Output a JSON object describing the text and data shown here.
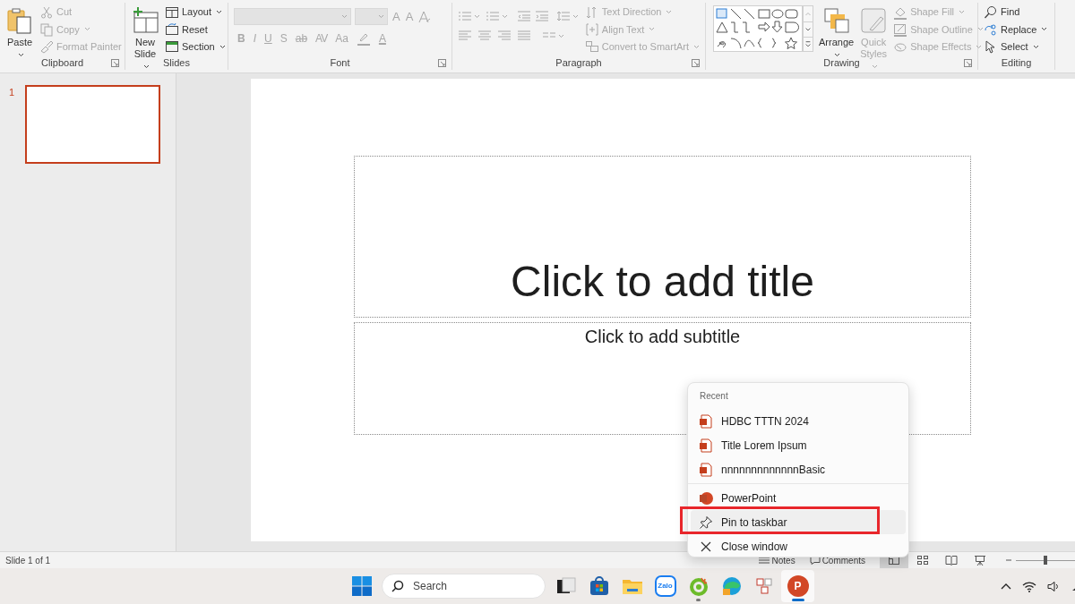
{
  "ribbon": {
    "groups": [
      {
        "kind": "stack",
        "label": "Clipboard",
        "launcher": true,
        "large": [
          {
            "label": "Paste",
            "kind": "paste",
            "disabled": false,
            "dropdown": true
          }
        ],
        "small": [
          {
            "label": "Cut",
            "kind": "cut",
            "disabled": true,
            "dropdown": false
          },
          {
            "label": "Copy",
            "kind": "copy",
            "disabled": true,
            "dropdown": true
          },
          {
            "label": "Format Painter",
            "kind": "brush",
            "disabled": true,
            "dropdown": false
          }
        ]
      },
      {
        "kind": "stack",
        "label": "Slides",
        "launcher": false,
        "large": [
          {
            "label": "New Slide",
            "kind": "newslide",
            "disabled": false,
            "dropdown": true
          }
        ],
        "small": [
          {
            "label": "Layout",
            "kind": "layout",
            "disabled": false,
            "dropdown": true
          },
          {
            "label": "Reset",
            "kind": "reset",
            "disabled": false,
            "dropdown": false
          },
          {
            "label": "Section",
            "kind": "section",
            "disabled": false,
            "dropdown": true
          }
        ]
      },
      {
        "kind": "font",
        "label": "Font",
        "launcher": true,
        "disabled": true,
        "row1": [
          {
            "label": "A",
            "kind": "grow"
          },
          {
            "label": "A",
            "kind": "shrink"
          },
          {
            "kind": "clear"
          }
        ],
        "row2": [
          {
            "label": "B",
            "kind": "bold"
          },
          {
            "label": "I",
            "kind": "italic"
          },
          {
            "label": "U",
            "kind": "underline"
          },
          {
            "label": "S",
            "kind": "shadow"
          },
          {
            "label": "ab",
            "kind": "strike"
          },
          {
            "label": "AV",
            "kind": "spacing"
          },
          {
            "label": "Aa",
            "kind": "case"
          },
          {
            "kind": "highlight"
          },
          {
            "label": "A",
            "kind": "color"
          }
        ]
      },
      {
        "kind": "paragraph",
        "label": "Paragraph",
        "launcher": true,
        "disabled": true,
        "small": [
          {
            "label": "Text Direction",
            "kind": "textdir",
            "disabled": true,
            "dropdown": true
          },
          {
            "label": "Align Text",
            "kind": "align",
            "disabled": true,
            "dropdown": true
          },
          {
            "label": "Convert to SmartArt",
            "kind": "smartart",
            "disabled": true,
            "dropdown": true
          }
        ]
      },
      {
        "kind": "drawing",
        "label": "Drawing",
        "launcher": true,
        "large": [
          {
            "label": "Arrange",
            "kind": "arrange",
            "disabled": false,
            "dropdown": true
          },
          {
            "label": "Quick Styles",
            "kind": "quickstyles",
            "disabled": true,
            "dropdown": true
          }
        ],
        "small": [
          {
            "label": "Shape Fill",
            "kind": "fill",
            "disabled": true,
            "dropdown": true
          },
          {
            "label": "Shape Outline",
            "kind": "outline",
            "disabled": true,
            "dropdown": true
          },
          {
            "label": "Shape Effects",
            "kind": "effects",
            "disabled": true,
            "dropdown": true
          }
        ]
      },
      {
        "kind": "stack",
        "label": "Editing",
        "launcher": false,
        "small": [
          {
            "label": "Find",
            "kind": "find",
            "disabled": false,
            "dropdown": false
          },
          {
            "label": "Replace",
            "kind": "replace",
            "disabled": false,
            "dropdown": true
          },
          {
            "label": "Select",
            "kind": "select",
            "disabled": false,
            "dropdown": true
          }
        ]
      }
    ]
  },
  "thumbnails": [
    {
      "number": "1",
      "selected": true
    }
  ],
  "slide": {
    "title": "Click to add title",
    "subtitle": "Click to add subtitle"
  },
  "status_bar": {
    "slide_info": "Slide 1 of 1",
    "notes": "Notes",
    "comments": "Comments",
    "views": [
      {
        "kind": "normal",
        "selected": true
      },
      {
        "kind": "sorter",
        "selected": false
      },
      {
        "kind": "reading",
        "selected": false
      },
      {
        "kind": "slideshow",
        "selected": false
      }
    ],
    "zoom": {
      "level": 0.5
    }
  },
  "jump_list": {
    "header": "Recent",
    "items": [
      {
        "kind": "file",
        "label": "HDBC TTTN 2024",
        "selected": false,
        "annotated": false
      },
      {
        "kind": "file",
        "label": "Title Lorem Ipsum",
        "selected": false,
        "annotated": false
      },
      {
        "kind": "file",
        "label": "nnnnnnnnnnnnnBasic",
        "selected": false,
        "annotated": false
      },
      {
        "kind": "separator"
      },
      {
        "kind": "app",
        "label": "PowerPoint",
        "selected": false,
        "annotated": false
      },
      {
        "kind": "pin",
        "label": "Pin to taskbar",
        "selected": true,
        "annotated": true
      },
      {
        "kind": "close",
        "label": "Close window",
        "selected": false,
        "annotated": false
      }
    ]
  },
  "taskbar": {
    "search": {
      "placeholder": "Search"
    },
    "apps": [
      {
        "kind": "taskview",
        "selected": false,
        "running": false
      },
      {
        "kind": "store",
        "selected": false,
        "running": false
      },
      {
        "kind": "explorer",
        "selected": false,
        "running": false
      },
      {
        "kind": "zalo",
        "label": "Zalo",
        "selected": false,
        "running": false
      },
      {
        "kind": "coccoc",
        "selected": false,
        "running": true
      },
      {
        "kind": "edge",
        "selected": false,
        "running": false
      },
      {
        "kind": "keys",
        "selected": false,
        "running": false
      },
      {
        "kind": "powerpoint",
        "label": "P",
        "selected": true,
        "running": true
      }
    ]
  }
}
